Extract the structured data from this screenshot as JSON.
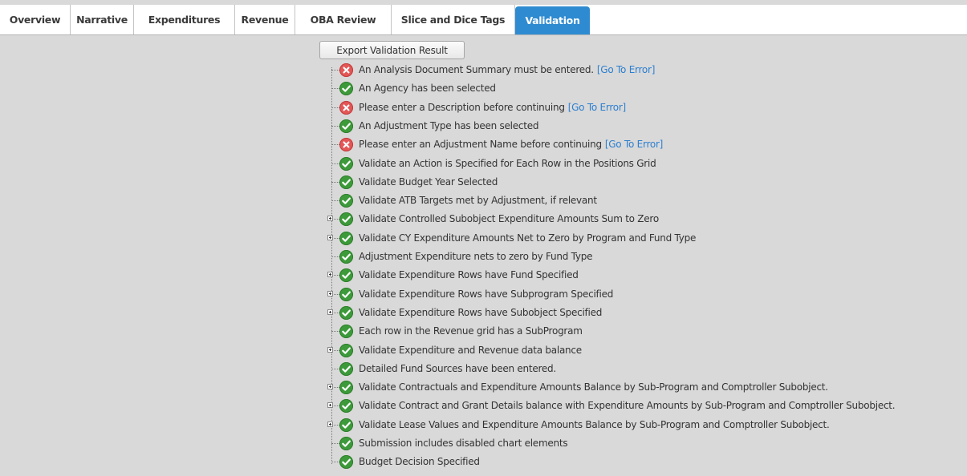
{
  "tabs": [
    {
      "label": "Overview",
      "active": false
    },
    {
      "label": "Narrative",
      "active": false
    },
    {
      "label": "Expenditures",
      "active": false
    },
    {
      "label": "Revenue",
      "active": false
    },
    {
      "label": "OBA Review",
      "active": false
    },
    {
      "label": "Slice and Dice Tags",
      "active": false
    },
    {
      "label": "Validation",
      "active": true
    }
  ],
  "export_button": "Export Validation Result",
  "colors": {
    "active_tab": "#2e8bd1",
    "link": "#2c7fd0",
    "ok": "#3d9a3a",
    "error": "#e35757",
    "background": "#d9d9d9"
  },
  "validation_items": [
    {
      "status": "error",
      "text": "An Analysis Document Summary must be entered.",
      "link": "[Go To Error]",
      "expandable": false
    },
    {
      "status": "ok",
      "text": "An Agency has been selected",
      "expandable": false
    },
    {
      "status": "error",
      "text": "Please enter a Description before continuing",
      "link": "[Go To Error]",
      "expandable": false
    },
    {
      "status": "ok",
      "text": "An Adjustment Type has been selected",
      "expandable": false
    },
    {
      "status": "error",
      "text": "Please enter an Adjustment Name before continuing",
      "link": "[Go To Error]",
      "expandable": false
    },
    {
      "status": "ok",
      "text": "Validate an Action is Specified for Each Row in the Positions Grid",
      "expandable": false
    },
    {
      "status": "ok",
      "text": "Validate Budget Year Selected",
      "expandable": false
    },
    {
      "status": "ok",
      "text": "Validate ATB Targets met by Adjustment, if relevant",
      "expandable": false
    },
    {
      "status": "ok",
      "text": "Validate Controlled Subobject Expenditure Amounts Sum to Zero",
      "expandable": true
    },
    {
      "status": "ok",
      "text": "Validate CY Expenditure Amounts Net to Zero by Program and Fund Type",
      "expandable": true
    },
    {
      "status": "ok",
      "text": "Adjustment Expenditure nets to zero by Fund Type",
      "expandable": false
    },
    {
      "status": "ok",
      "text": "Validate Expenditure Rows have Fund Specified",
      "expandable": true
    },
    {
      "status": "ok",
      "text": "Validate Expenditure Rows have Subprogram Specified",
      "expandable": true
    },
    {
      "status": "ok",
      "text": "Validate Expenditure Rows have Subobject Specified",
      "expandable": true
    },
    {
      "status": "ok",
      "text": "Each row in the Revenue grid has a SubProgram",
      "expandable": false
    },
    {
      "status": "ok",
      "text": "Validate Expenditure and Revenue data balance",
      "expandable": true
    },
    {
      "status": "ok",
      "text": "Detailed Fund Sources have been entered.",
      "expandable": false
    },
    {
      "status": "ok",
      "text": "Validate Contractuals and Expenditure Amounts Balance by Sub-Program and Comptroller Subobject.",
      "expandable": true
    },
    {
      "status": "ok",
      "text": "Validate Contract and Grant Details balance with Expenditure Amounts by Sub-Program and Comptroller Subobject.",
      "expandable": true
    },
    {
      "status": "ok",
      "text": "Validate Lease Values and Expenditure Amounts Balance by Sub-Program and Comptroller Subobject.",
      "expandable": true
    },
    {
      "status": "ok",
      "text": "Submission includes disabled chart elements",
      "expandable": false
    },
    {
      "status": "ok",
      "text": "Budget Decision Specified",
      "expandable": false
    }
  ]
}
